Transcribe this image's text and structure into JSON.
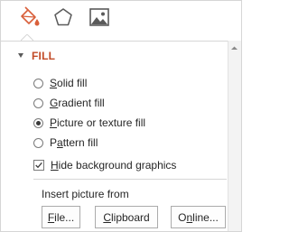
{
  "tabs": [
    {
      "name": "fill-line-tab",
      "icon": "paint-bucket-icon",
      "active": true
    },
    {
      "name": "effects-tab",
      "icon": "pentagon-icon",
      "active": false
    },
    {
      "name": "picture-tab",
      "icon": "picture-icon",
      "active": false
    }
  ],
  "section": {
    "title": "FILL",
    "expanded": true
  },
  "fill_options": [
    {
      "prefix": "",
      "accel": "S",
      "rest": "olid fill",
      "checked": false
    },
    {
      "prefix": "",
      "accel": "G",
      "rest": "radient fill",
      "checked": false
    },
    {
      "prefix": "",
      "accel": "P",
      "rest": "icture or texture fill",
      "checked": true
    },
    {
      "prefix": "P",
      "accel": "a",
      "rest": "ttern fill",
      "checked": false
    }
  ],
  "hide_background": {
    "prefix": "",
    "accel": "H",
    "rest": "ide background graphics",
    "checked": true
  },
  "insert_picture": {
    "label": "Insert picture from",
    "file": {
      "accel": "F",
      "rest": "ile..."
    },
    "clipboard": {
      "accel": "C",
      "rest": "lipboard"
    },
    "online": {
      "accel": "",
      "prefix": "O",
      "accel2": "n",
      "rest": "line..."
    }
  },
  "colors": {
    "accent": "#c24a26",
    "border": "#d6d6d6"
  }
}
